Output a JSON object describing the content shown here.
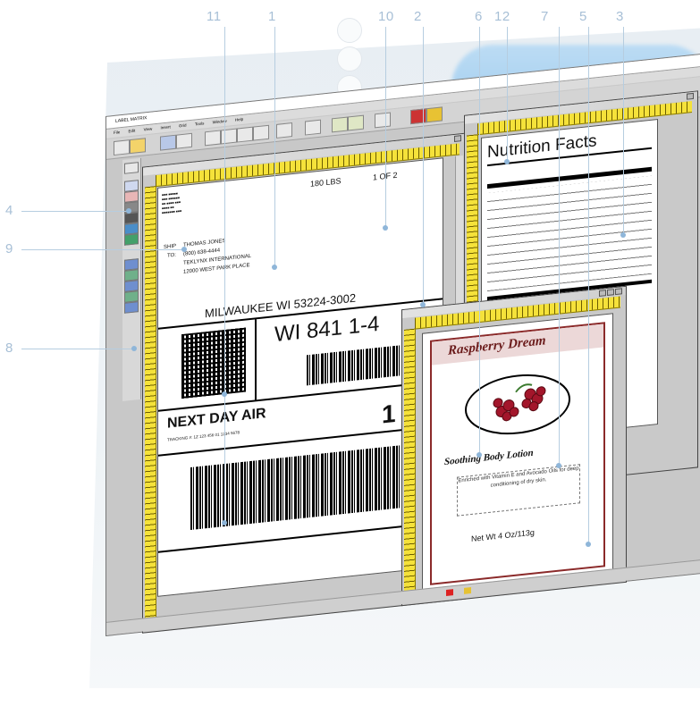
{
  "callouts": {
    "n1": "1",
    "n2": "2",
    "n3": "3",
    "n4": "4",
    "n5": "5",
    "n6": "6",
    "n7": "7",
    "n8": "8",
    "n9": "9",
    "n10": "10",
    "n11": "11",
    "n12": "12"
  },
  "app": {
    "title": "LABEL MATRIX",
    "menu": [
      "File",
      "Edit",
      "View",
      "Insert",
      "Grid",
      "Tools",
      "Window",
      "Help"
    ]
  },
  "shipping_label": {
    "weight": "180 LBS",
    "page_of": "1 OF 2",
    "ship_label": "SHIP",
    "to_label": "TO:",
    "recipient": [
      "THOMAS JONES",
      "(800) 638-4444",
      "TEKLYNX INTERNATIONAL",
      "12000 WEST PARK PLACE"
    ],
    "city_line": "MILWAUKEE WI 53224-3002",
    "route_code": "WI 841 1-4",
    "service": "NEXT DAY AIR",
    "service_number": "1",
    "tracking": "TRACKING #: 1Z 123 456 01 1234 5678"
  },
  "nutrition": {
    "title": "Nutrition Facts"
  },
  "raspberry": {
    "title": "Raspberry Dream",
    "subtitle": "Soothing Body Lotion",
    "description": "Enriched with Vitamin E and Avocado Oils for deep conditioning of dry skin.",
    "net_wt": "Net Wt 4 Oz/113g"
  },
  "colors": {
    "ruler": "#f5e23a",
    "callout": "#a7bfd6",
    "raspberry_border": "#8b2a2a"
  }
}
